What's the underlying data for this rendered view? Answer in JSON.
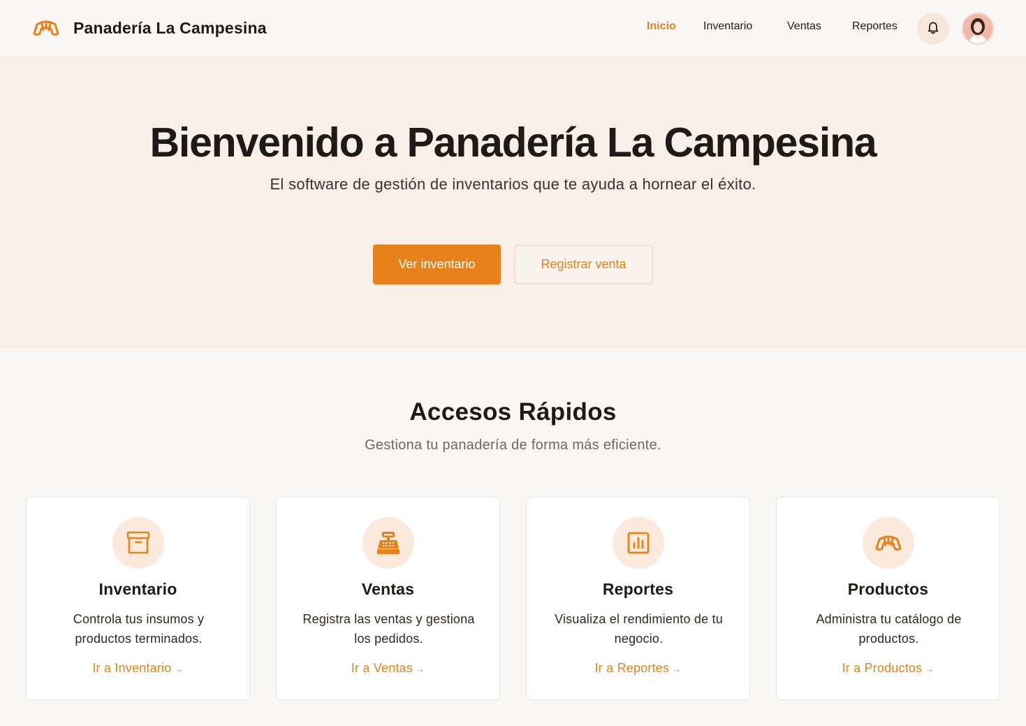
{
  "header": {
    "brand_name": "Panadería La Campesina",
    "brand_icon": "croissant-icon",
    "nav": [
      {
        "label": "Inicio",
        "active": true
      },
      {
        "label": "Inventario",
        "active": false
      },
      {
        "label": "Ventas",
        "active": false
      },
      {
        "label": "Reportes",
        "active": false
      }
    ],
    "notifications_icon": "bell-icon",
    "avatar_icon": "user-avatar"
  },
  "hero": {
    "title": "Bienvenido a Panadería La Campesina",
    "subtitle": "El software de gestión de inventarios que te ayuda a hornear el éxito.",
    "primary_button": "Ver inventario",
    "secondary_button": "Registrar venta"
  },
  "quick_access": {
    "title": "Accesos Rápidos",
    "subtitle": "Gestiona tu panadería de forma más eficiente.",
    "cards": [
      {
        "icon": "archive-box-icon",
        "title": "Inventario",
        "description": "Controla tus insumos y productos terminados.",
        "link": "Ir a Inventario"
      },
      {
        "icon": "cash-register-icon",
        "title": "Ventas",
        "description": "Registra las ventas y gestiona los pedidos.",
        "link": "Ir a Ventas"
      },
      {
        "icon": "bar-chart-icon",
        "title": "Reportes",
        "description": "Visualiza el rendimiento de tu negocio.",
        "link": "Ir a Reportes"
      },
      {
        "icon": "croissant-icon",
        "title": "Productos",
        "description": "Administra tu catálogo de productos.",
        "link": "Ir a Productos"
      }
    ]
  },
  "colors": {
    "accent": "#e8811a",
    "hero_background": "#f8efe9",
    "page_background": "#f9f7f5",
    "icon_circle": "#fbe9dc"
  }
}
